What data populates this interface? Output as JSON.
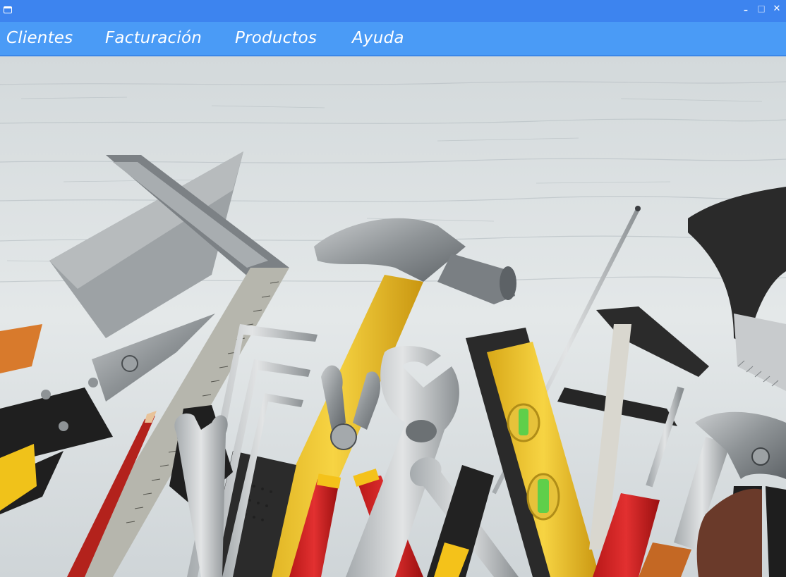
{
  "window": {
    "icon": "window-app-icon",
    "controls": {
      "minimize": "–",
      "maximize": "□",
      "close": "✕"
    },
    "titlebar_color": "#3d84ef"
  },
  "menubar": {
    "color": "#4a9bf6",
    "items": [
      {
        "label": "Clientes"
      },
      {
        "label": "Facturación"
      },
      {
        "label": "Productos"
      },
      {
        "label": "Ayuda"
      }
    ]
  },
  "background_image": {
    "subject": "tools-on-wooden-table"
  }
}
